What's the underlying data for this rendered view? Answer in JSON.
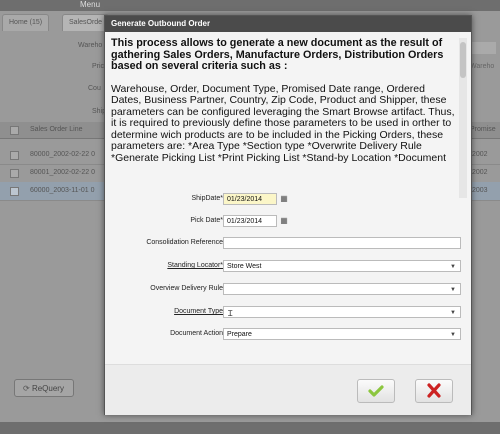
{
  "background": {
    "menu": "Menu",
    "tabs": [
      "Home (15)",
      "SalesOrde"
    ],
    "labels": [
      "Wareho",
      "Pric",
      "Cou",
      "Ship"
    ],
    "grid_header": "Sales Order Line",
    "grid_header_right": "Promise",
    "rows": [
      {
        "left": "80000_2002-02-22 0",
        "right": "/2002"
      },
      {
        "left": "80001_2002-02-22 0",
        "right": "/2002"
      },
      {
        "left": "60000_2003-11-01 0",
        "right": "/2003"
      }
    ],
    "requery_button": "ReQuery"
  },
  "dialog": {
    "title": "Generate Outbound Order",
    "description_bold": "This process allows to generate a new document as the result of gathering Sales Orders, Manufacture Orders, Distribution Orders based on several criteria such as :",
    "description_body": "Warehouse, Order, Document Type, Promised Date range, Ordered Dates, Business Partner, Country, Zip Code, Product and Shipper, these parameters can be configured leveraging the Smart Browse artifact. Thus, it is required to previously define those parameters to be used in orther to determine wich products are to be included in the Picking Orders, these parameters are: *Area Type *Section type *Overwrite Delivery Rule *Generate Picking List *Print Picking List *Stand-by Location *Document",
    "fields": {
      "ship_date": {
        "label": "ShipDate*",
        "value": "01/23/2014"
      },
      "pick_date": {
        "label": "Pick Date*",
        "value": "01/23/2014"
      },
      "consolidation": {
        "label": "Consolidation Reference",
        "value": ""
      },
      "standing_locator": {
        "label": "Standing Locator*",
        "value": "Store West"
      },
      "overview_delivery": {
        "label": "Overview Delivery Rule",
        "value": ""
      },
      "document_type": {
        "label": "Document Type",
        "value": ""
      },
      "document_action": {
        "label": "Document Action",
        "value": "Prepare"
      }
    },
    "colors": {
      "ok": "#8cc63f",
      "cancel": "#cc2222"
    }
  }
}
